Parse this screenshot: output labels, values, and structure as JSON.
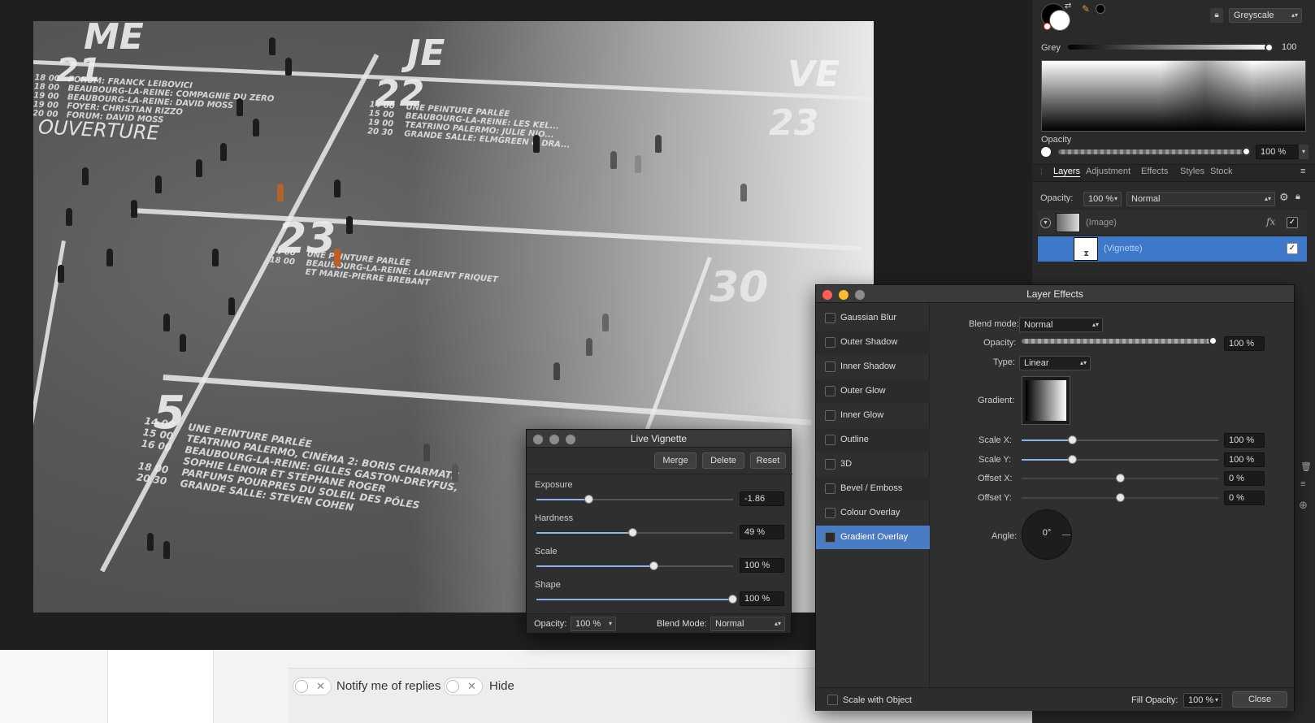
{
  "colors": {
    "accent": "#4a7cc4",
    "panel": "#2a2a2a",
    "selection": "#3d78c9"
  },
  "photo": {
    "days": [
      "ME",
      "JE",
      "VE"
    ],
    "numbers": [
      "21",
      "22",
      "23",
      "23",
      "30",
      "5"
    ],
    "ouverture": "OUVERTURE"
  },
  "web": {
    "notify_label": "Notify me of replies",
    "hide_label": "Hide"
  },
  "color_panel": {
    "mode": "Greyscale",
    "grey_label": "Grey",
    "grey_value": "100",
    "opacity_label": "Opacity",
    "opacity_value": "100 %"
  },
  "layers_panel": {
    "tabs": [
      "Layers",
      "Adjustment",
      "Effects",
      "Styles",
      "Stock"
    ],
    "opacity_label": "Opacity:",
    "opacity_value": "100 %",
    "blend_mode": "Normal",
    "layers": [
      {
        "name": "(Image)",
        "checked": "✓"
      },
      {
        "name": "(Vignette)",
        "checked": "✓"
      }
    ]
  },
  "live_vignette": {
    "title": "Live Vignette",
    "buttons": {
      "merge": "Merge",
      "delete": "Delete",
      "reset": "Reset"
    },
    "params": [
      {
        "label": "Exposure",
        "value": "-1.86",
        "level": 0.27
      },
      {
        "label": "Hardness",
        "value": "49 %",
        "level": 0.49
      },
      {
        "label": "Scale",
        "value": "100 %",
        "level": 0.6
      },
      {
        "label": "Shape",
        "value": "100 %",
        "level": 1.0
      }
    ],
    "footer": {
      "opacity_label": "Opacity:",
      "opacity_value": "100 %",
      "blend_label": "Blend Mode:",
      "blend_value": "Normal"
    }
  },
  "layer_effects": {
    "title": "Layer Effects",
    "effects": [
      "Gaussian Blur",
      "Outer Shadow",
      "Inner Shadow",
      "Outer Glow",
      "Inner Glow",
      "Outline",
      "3D",
      "Bevel / Emboss",
      "Colour Overlay",
      "Gradient Overlay"
    ],
    "selected": "Gradient Overlay",
    "blend_mode_label": "Blend mode:",
    "blend_mode_value": "Normal",
    "opacity_label": "Opacity:",
    "opacity_value": "100 %",
    "type_label": "Type:",
    "type_value": "Linear",
    "gradient_label": "Gradient:",
    "scale_x_label": "Scale X:",
    "scale_x_value": "100 %",
    "scale_y_label": "Scale Y:",
    "scale_y_value": "100 %",
    "offset_x_label": "Offset X:",
    "offset_x_value": "0 %",
    "offset_y_label": "Offset Y:",
    "offset_y_value": "0 %",
    "angle_label": "Angle:",
    "angle_value": "0°",
    "scale_with_object": "Scale with Object",
    "fill_opacity_label": "Fill Opacity:",
    "fill_opacity_value": "100 %",
    "close_label": "Close"
  }
}
